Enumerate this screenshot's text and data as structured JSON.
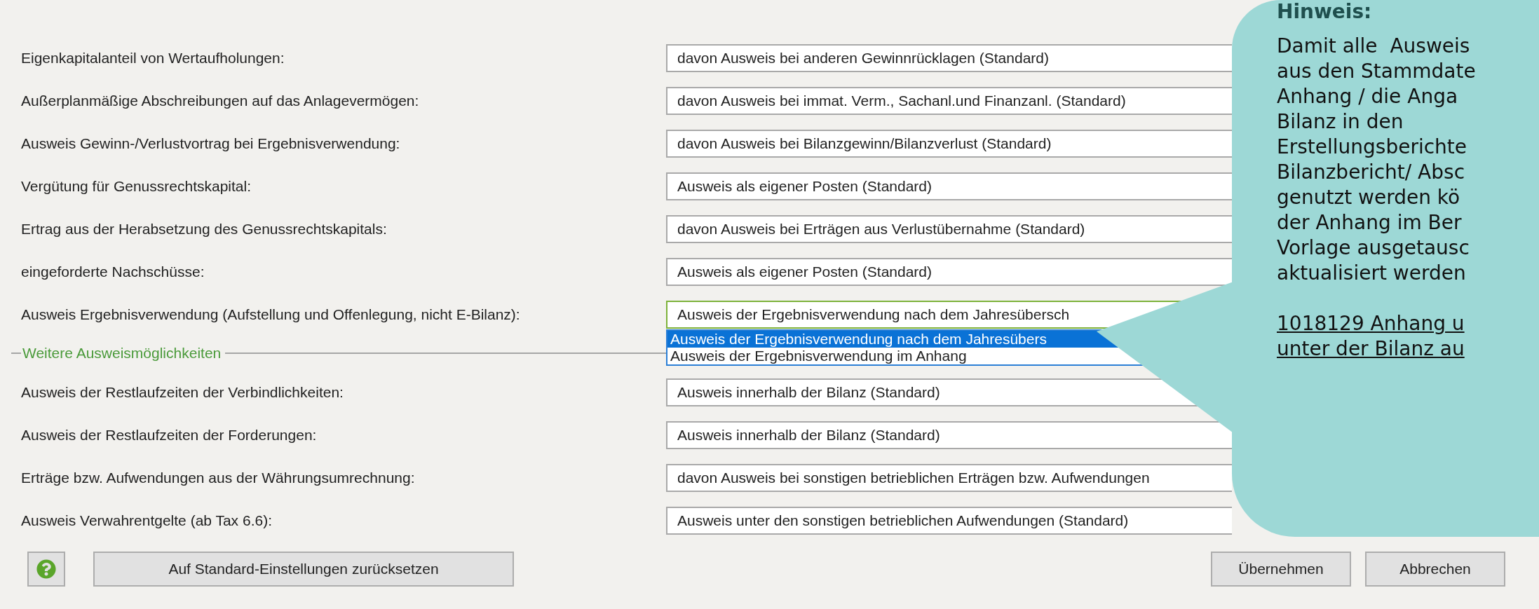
{
  "settings": [
    {
      "label": "Eigenkapitalanteil von Wertaufholungen:",
      "value": "davon Ausweis bei anderen Gewinnrücklagen (Standard)",
      "open": false
    },
    {
      "label": "Außerplanmäßige Abschreibungen auf das Anlagevermögen:",
      "value": "davon Ausweis bei immat. Verm., Sachanl.und Finanzanl. (Standard)",
      "open": false
    },
    {
      "label": "Ausweis Gewinn-/Verlustvortrag bei Ergebnisverwendung:",
      "value": "davon Ausweis bei Bilanzgewinn/Bilanzverlust (Standard)",
      "open": false
    },
    {
      "label": "Vergütung für Genussrechtskapital:",
      "value": "Ausweis als eigener Posten (Standard)",
      "open": false
    },
    {
      "label": "Ertrag aus der Herabsetzung des Genussrechtskapitals:",
      "value": "davon Ausweis bei Erträgen aus Verlustübernahme (Standard)",
      "open": false
    },
    {
      "label": "eingeforderte Nachschüsse:",
      "value": "Ausweis als eigener Posten (Standard)",
      "open": false
    },
    {
      "label": "Ausweis Ergebnisverwendung (Aufstellung und Offenlegung, nicht E-Bilanz):",
      "value": "Ausweis der Ergebnisverwendung nach dem Jahresübersch",
      "open": true,
      "options": [
        {
          "label": "Ausweis der Ergebnisverwendung nach dem Jahresübers",
          "selected": true
        },
        {
          "label": "Ausweis der Ergebnisverwendung im Anhang",
          "selected": false
        }
      ]
    }
  ],
  "section": {
    "title": "Weitere Ausweismöglichkeiten"
  },
  "more_settings": [
    {
      "label": "Ausweis der Restlaufzeiten der Verbindlichkeiten:",
      "value": "Ausweis innerhalb der Bilanz (Standard)",
      "open": false
    },
    {
      "label": "Ausweis der Restlaufzeiten der Forderungen:",
      "value": "Ausweis innerhalb der Bilanz (Standard)",
      "open": false
    },
    {
      "label": "Erträge bzw. Aufwendungen aus der Währungsumrechnung:",
      "value": "davon Ausweis bei sonstigen betrieblichen Erträgen bzw. Aufwendungen",
      "open": false
    },
    {
      "label": "Ausweis Verwahrentgelte (ab Tax 6.6):",
      "value": "Ausweis unter den sonstigen betrieblichen Aufwendungen (Standard)",
      "open": false
    }
  ],
  "buttons": {
    "reset": "Auf Standard-Einstellungen zurücksetzen",
    "apply": "Übernehmen",
    "cancel": "Abbrechen"
  },
  "callout": {
    "title": "Hinweis:",
    "lines": [
      "Damit alle  Ausweis",
      "aus den Stammdate",
      "Anhang / die Anga",
      "Bilanz in den",
      "Erstellungsberichte",
      "Bilanzbericht/ Absc",
      "genutzt werden kö",
      "der Anhang im Ber",
      "Vorlage ausgetausc",
      "aktualisiert werden"
    ],
    "link_lines": [
      "1018129 Anhang u",
      "unter der Bilanz au"
    ]
  }
}
